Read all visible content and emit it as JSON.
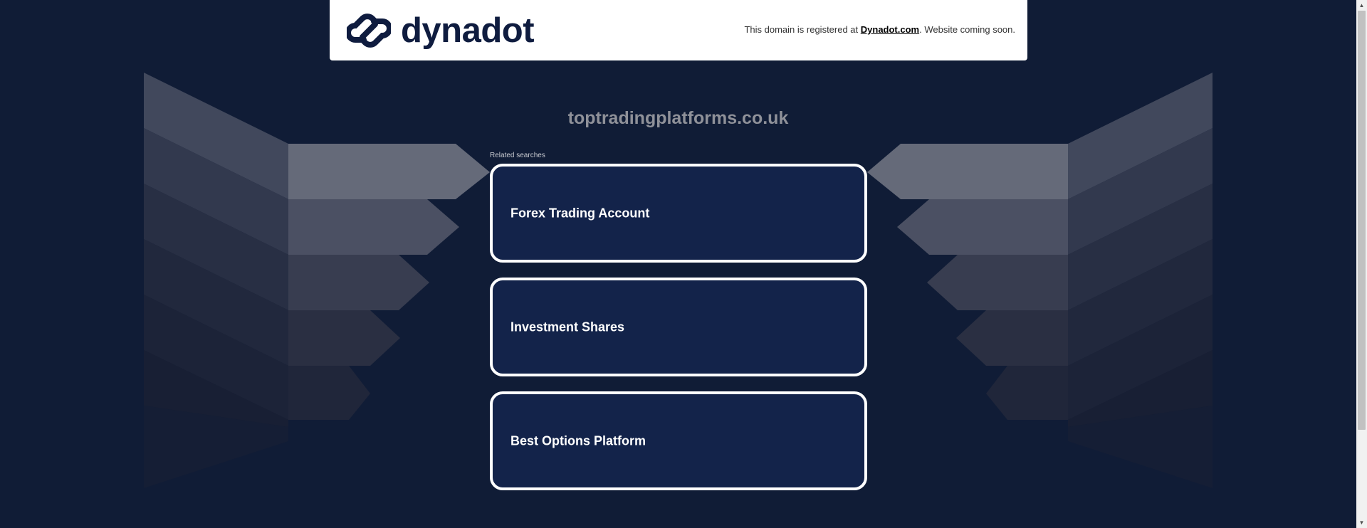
{
  "header": {
    "brand": "dynadot",
    "notice_prefix": "This domain is registered at ",
    "notice_link": "Dynadot.com",
    "notice_suffix": ". Website coming soon."
  },
  "main": {
    "domain": "toptradingplatforms.co.uk",
    "related_label": "Related searches",
    "links": [
      {
        "label": "Forex Trading Account"
      },
      {
        "label": "Investment Shares"
      },
      {
        "label": "Best Options Platform"
      }
    ]
  },
  "colors": {
    "background": "#101c36",
    "card": "#13234a",
    "brand": "#0f1c3f"
  },
  "icons": {
    "logo": "chain-link-logo-icon",
    "scroll_up": "scroll-up-arrow-icon",
    "scroll_down": "scroll-down-arrow-icon"
  }
}
